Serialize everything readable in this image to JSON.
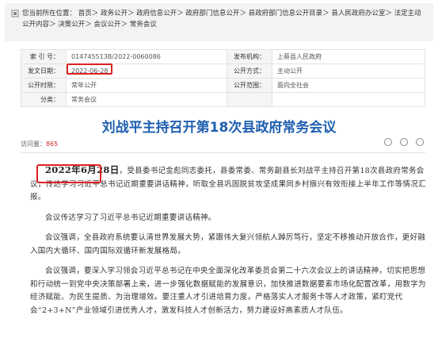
{
  "breadcrumb": {
    "label": "您当前所在位置：",
    "items": [
      "首页",
      "政务公开",
      "政府信息公开",
      "政府部门信息公开",
      "县政府部门信息公开目录",
      "县人民政府办公室",
      "法定主动公开内容",
      "决策公开",
      "会议公开",
      "常务会议"
    ]
  },
  "meta": {
    "index_label": "索 引 号：",
    "index_value": "014745513B/2022-0060086",
    "agency_label": "发布机构：",
    "agency_value": "上蔡县人民政府",
    "date_label": "发文日期：",
    "date_value": "2022-06-28",
    "method_label": "公开方式：",
    "method_value": "主动公开",
    "time_label": "公开时限：",
    "time_value": "常年公开",
    "scope_label": "公开范围：",
    "scope_value": "面向全社会",
    "category_label": "分类：",
    "category_value": "常务会议"
  },
  "article": {
    "title": "刘战平主持召开第18次县政府常务会议",
    "views_label": "访问量：",
    "views_count": "865",
    "date": "2022年6月28日",
    "p1_rest": "，受县委书记金彪同志委托，县委常委、常务副县长刘战平主持召开第18次县政府常务会议，传达学习习近平总书记近期重要讲话精神，听取全县巩固脱贫攻坚成果同乡村振兴有效衔接上半年工作等情况汇报。",
    "p2": "会议传达学习了习近平总书记近期重要讲话精神。",
    "p3": "会议强调，全县政府系统要认清世界发展大势，紧跟伟大复兴领航人踔厉笃行，坚定不移推动开放合作，更好融入国内大循环、国内国际双循环新发展格局。",
    "p4": "会议强调，要深入学习领会习近平总书记在中央全面深化改革委员会第二十六次会议上的讲话精神，切实把思想和行动统一到党中央决策部署上来，进一步强化数据赋能的发展意识，加快推进数据要素市场化配置改革，用数字为经济赋能、为民生提质、为治理增效。要注重人才引进培育力度，严格落实人才服务卡等人才政策，紧盯党代会“2+3+N”产业领域引进优秀人才，激发科技人才创新活力，努力建设好高素质人才队伍。"
  }
}
